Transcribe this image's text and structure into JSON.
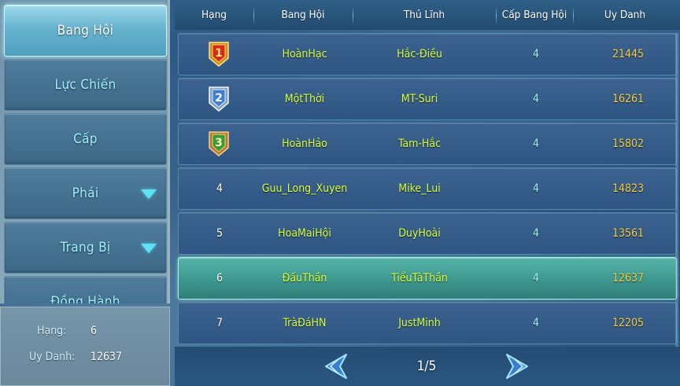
{
  "sidebar": {
    "items": [
      {
        "label": "Bang Hội",
        "active": true
      },
      {
        "label": "Lực Chiến"
      },
      {
        "label": "Cấp"
      },
      {
        "label": "Phái",
        "dropdown": true
      },
      {
        "label": "Trang Bị",
        "dropdown": true
      },
      {
        "label": "Đồng Hành"
      }
    ]
  },
  "my_info": {
    "rank_label": "Hạng:",
    "rank_value": "6",
    "fame_label": "Uy Danh:",
    "fame_value": "12637"
  },
  "table": {
    "headers": [
      "Hạng",
      "Bang Hội",
      "Thủ Lĩnh",
      "Cấp Bang Hội",
      "Uy Danh"
    ],
    "rows": [
      {
        "rank": "1",
        "guild": "HoànHạc",
        "leader": "Hắc-Điều",
        "level": "4",
        "fame": "21445",
        "medal": "gold"
      },
      {
        "rank": "2",
        "guild": "MộtThời",
        "leader": "MT-Suri",
        "level": "4",
        "fame": "16261",
        "medal": "silver"
      },
      {
        "rank": "3",
        "guild": "HoànHảo",
        "leader": "Tam-Hắc",
        "level": "4",
        "fame": "15802",
        "medal": "bronze"
      },
      {
        "rank": "4",
        "guild": "Guu_Long_Xuyen",
        "leader": "Mike_Lui",
        "level": "4",
        "fame": "14823"
      },
      {
        "rank": "5",
        "guild": "HoaMaiHội",
        "leader": "DuyHoài",
        "level": "4",
        "fame": "13561"
      },
      {
        "rank": "6",
        "guild": "ĐấuThần",
        "leader": "TiểuTàThần",
        "level": "4",
        "fame": "12637",
        "highlighted": true
      },
      {
        "rank": "7",
        "guild": "TràĐáHN",
        "leader": "JustMinh",
        "level": "4",
        "fame": "12205"
      }
    ]
  },
  "pager": {
    "text": "1/5"
  },
  "icons": {
    "prev": "left-arrow-icon",
    "next": "right-arrow-icon",
    "dropdown": "triangle-down-icon",
    "medal": "rank-medal-icon"
  },
  "colors": {
    "guild_text": "#d8ff3a",
    "fame_text": "#f7cf3d",
    "level_text": "#9ff3ff",
    "highlight_row": "#3d978e"
  }
}
